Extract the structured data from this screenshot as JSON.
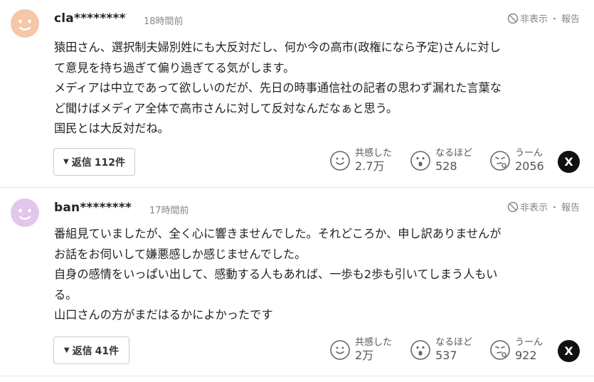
{
  "comments": [
    {
      "user": "cla********",
      "time": "18時間前",
      "hide_label": "非表示",
      "report_label": "報告",
      "avatar_color": "#f5c6a8",
      "body": [
        "猿田さん、選択制夫婦別姓にも大反対だし、何か今の高市(政権になら予定)さんに対し",
        "て意見を持ち過ぎて偏り過ぎてる気がします。",
        "メディアは中立であって欲しいのだが、先日の時事通信社の記者の思わず漏れた言葉な",
        "ど聞けばメディア全体で高市さんに対して反対なんだなぁと思う。",
        "国民とは大反対だね。"
      ],
      "reply_label": "返信",
      "reply_count": "112件",
      "reactions": [
        {
          "label": "共感した",
          "count": "2.7万",
          "icon": "smile-icon"
        },
        {
          "label": "なるほど",
          "count": "528",
          "icon": "surprised-icon"
        },
        {
          "label": "うーん",
          "count": "2056",
          "icon": "thinking-icon"
        }
      ],
      "share_label": "X"
    },
    {
      "user": "ban********",
      "time": "17時間前",
      "hide_label": "非表示",
      "report_label": "報告",
      "avatar_color": "#e2c6ec",
      "body": [
        "番組見ていましたが、全く心に響きませんでした。それどころか、申し訳ありませんが",
        "お話をお伺いして嫌悪感しか感じませんでした。",
        "自身の感情をいっぱい出して、感動する人もあれば、一歩も2歩も引いてしまう人もい",
        "る。",
        "山口さんの方がまだはるかによかったです"
      ],
      "reply_label": "返信",
      "reply_count": "41件",
      "reactions": [
        {
          "label": "共感した",
          "count": "2万",
          "icon": "smile-icon"
        },
        {
          "label": "なるほど",
          "count": "537",
          "icon": "surprised-icon"
        },
        {
          "label": "うーん",
          "count": "922",
          "icon": "thinking-icon"
        }
      ],
      "share_label": "X"
    }
  ]
}
